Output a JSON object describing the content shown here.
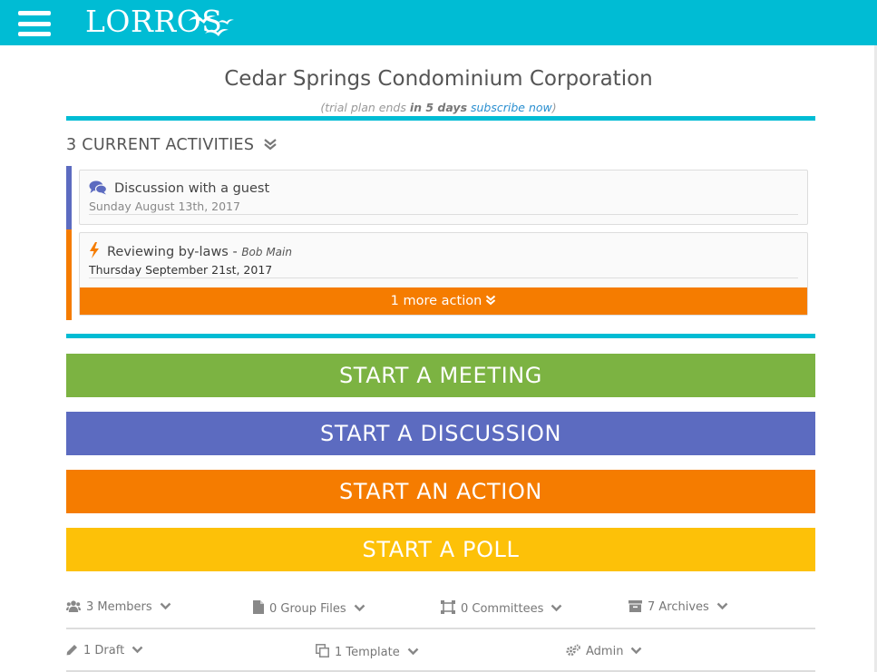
{
  "app": {
    "logo_text": "LORROS",
    "menu_icon": "hamburger-menu-icon"
  },
  "org": {
    "title": "Cedar Springs Condominium Corporation",
    "trial_prefix": "(trial plan ends ",
    "trial_bold": "in 5 days",
    "trial_link": "subscribe now",
    "trial_suffix": ")"
  },
  "activities": {
    "header": "3 CURRENT ACTIVITIES",
    "items": [
      {
        "title": "Discussion with a guest",
        "who": "",
        "date": "Sunday August 13th, 2017",
        "icon": "discussion-bubbles-icon",
        "color": "#5c6bc0"
      },
      {
        "title": "Reviewing by-laws",
        "who": "Bob Main",
        "date": "Thursday September 21st, 2017",
        "icon": "lightning-bolt-icon",
        "color": "#f57c00"
      }
    ],
    "more_label": "1 more action"
  },
  "actions": {
    "meeting": "START A MEETING",
    "discussion": "START A DISCUSSION",
    "action": "START AN ACTION",
    "poll": "START A POLL"
  },
  "colors": {
    "topbar": "#00bcd4",
    "meeting": "#7cb342",
    "discussion": "#5c6bc0",
    "action": "#f57c00",
    "poll": "#fdc108"
  },
  "meta_row1": [
    {
      "label": "3 Members",
      "icon": "members-icon"
    },
    {
      "label": "0 Group Files",
      "icon": "file-icon"
    },
    {
      "label": "0 Committees",
      "icon": "committees-icon"
    },
    {
      "label": "7 Archives",
      "icon": "archive-box-icon"
    }
  ],
  "meta_row2": [
    {
      "label": "1 Draft",
      "icon": "pencil-icon"
    },
    {
      "label": "1 Template",
      "icon": "copy-template-icon"
    },
    {
      "label": "Admin",
      "icon": "gears-icon"
    }
  ]
}
